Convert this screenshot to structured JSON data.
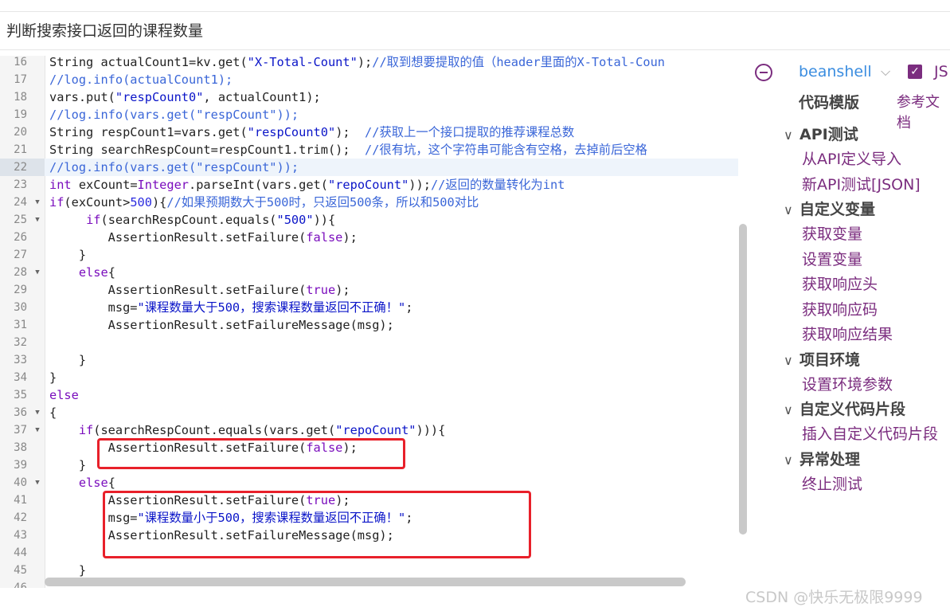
{
  "page_title": "判断搜索接口返回的课程数量",
  "code_lines": [
    {
      "n": "16",
      "fold": false,
      "active": false,
      "segs": [
        [
          "",
          "String actualCount1=kv.get("
        ],
        [
          "c-str",
          "\"X-Total-Count\""
        ],
        [
          "",
          ");"
        ],
        [
          "c-com",
          "//取到想要提取的值（header里面的X-Total-Coun"
        ]
      ]
    },
    {
      "n": "17",
      "fold": false,
      "active": false,
      "segs": [
        [
          "c-com",
          "//log.info(actualCount1);"
        ]
      ]
    },
    {
      "n": "18",
      "fold": false,
      "active": false,
      "segs": [
        [
          "",
          "vars.put("
        ],
        [
          "c-str",
          "\"respCount0\""
        ],
        [
          "",
          ", actualCount1);"
        ]
      ]
    },
    {
      "n": "19",
      "fold": false,
      "active": false,
      "segs": [
        [
          "c-com",
          "//log.info(vars.get(\"respCount\"));"
        ]
      ]
    },
    {
      "n": "20",
      "fold": false,
      "active": false,
      "segs": [
        [
          "",
          "String respCount1=vars.get("
        ],
        [
          "c-str",
          "\"respCount0\""
        ],
        [
          "",
          ");  "
        ],
        [
          "c-com",
          "//获取上一个接口提取的推荐课程总数"
        ]
      ]
    },
    {
      "n": "21",
      "fold": false,
      "active": false,
      "segs": [
        [
          "",
          "String searchRespCount=respCount1.trim();  "
        ],
        [
          "c-com",
          "//很有坑，这个字符串可能含有空格，去掉前后空格"
        ]
      ]
    },
    {
      "n": "22",
      "fold": false,
      "active": true,
      "segs": [
        [
          "c-com",
          "//log.info(vars.get(\"respCount\"));"
        ]
      ]
    },
    {
      "n": "23",
      "fold": false,
      "active": false,
      "segs": [
        [
          "c-kw",
          "int"
        ],
        [
          "",
          " exCount="
        ],
        [
          "c-kw",
          "Integer"
        ],
        [
          "",
          ".parseInt(vars.get("
        ],
        [
          "c-str",
          "\"repoCount\""
        ],
        [
          "",
          "));"
        ],
        [
          "c-com",
          "//返回的数量转化为int"
        ]
      ]
    },
    {
      "n": "24",
      "fold": true,
      "active": false,
      "segs": [
        [
          "c-kw",
          "if"
        ],
        [
          "",
          "(exCount>"
        ],
        [
          "c-num",
          "500"
        ],
        [
          "",
          "){"
        ],
        [
          "c-com",
          "//如果预期数大于500时，只返回500条，所以和500对比"
        ]
      ]
    },
    {
      "n": "25",
      "fold": true,
      "active": false,
      "segs": [
        [
          "",
          "     "
        ],
        [
          "c-kw",
          "if"
        ],
        [
          "",
          "(searchRespCount.equals("
        ],
        [
          "c-str",
          "\"500\""
        ],
        [
          "",
          "))"
        ],
        [
          "",
          "{"
        ]
      ]
    },
    {
      "n": "26",
      "fold": false,
      "active": false,
      "segs": [
        [
          "",
          "        AssertionResult.setFailure("
        ],
        [
          "c-kw",
          "false"
        ],
        [
          "",
          ");"
        ]
      ]
    },
    {
      "n": "27",
      "fold": false,
      "active": false,
      "segs": [
        [
          "",
          "    }"
        ]
      ]
    },
    {
      "n": "28",
      "fold": true,
      "active": false,
      "segs": [
        [
          "",
          "    "
        ],
        [
          "c-kw",
          "else"
        ],
        [
          "",
          "{"
        ]
      ]
    },
    {
      "n": "29",
      "fold": false,
      "active": false,
      "segs": [
        [
          "",
          "        AssertionResult.setFailure("
        ],
        [
          "c-kw",
          "true"
        ],
        [
          "",
          ");"
        ]
      ]
    },
    {
      "n": "30",
      "fold": false,
      "active": false,
      "segs": [
        [
          "",
          "        msg="
        ],
        [
          "c-str",
          "\"课程数量大于500，搜索课程数量返回不正确！\""
        ],
        [
          "",
          ";"
        ]
      ]
    },
    {
      "n": "31",
      "fold": false,
      "active": false,
      "segs": [
        [
          "",
          "        AssertionResult.setFailureMessage(msg);"
        ]
      ]
    },
    {
      "n": "32",
      "fold": false,
      "active": false,
      "segs": [
        [
          "",
          ""
        ]
      ]
    },
    {
      "n": "33",
      "fold": false,
      "active": false,
      "segs": [
        [
          "",
          "    }"
        ]
      ]
    },
    {
      "n": "34",
      "fold": false,
      "active": false,
      "segs": [
        [
          "",
          "}"
        ]
      ]
    },
    {
      "n": "35",
      "fold": false,
      "active": false,
      "segs": [
        [
          "c-kw",
          "else"
        ]
      ]
    },
    {
      "n": "36",
      "fold": true,
      "active": false,
      "segs": [
        [
          "",
          "{"
        ]
      ]
    },
    {
      "n": "37",
      "fold": true,
      "active": false,
      "segs": [
        [
          "",
          "    "
        ],
        [
          "c-kw",
          "if"
        ],
        [
          "",
          "(searchRespCount.equals(vars.get("
        ],
        [
          "c-str",
          "\"repoCount\""
        ],
        [
          "",
          ")))"
        ],
        [
          "",
          "{"
        ]
      ]
    },
    {
      "n": "38",
      "fold": false,
      "active": false,
      "segs": [
        [
          "",
          "        AssertionResult.setFailure("
        ],
        [
          "c-kw",
          "false"
        ],
        [
          "",
          ");"
        ]
      ]
    },
    {
      "n": "39",
      "fold": false,
      "active": false,
      "segs": [
        [
          "",
          "    }"
        ]
      ]
    },
    {
      "n": "40",
      "fold": true,
      "active": false,
      "segs": [
        [
          "",
          "    "
        ],
        [
          "c-kw",
          "else"
        ],
        [
          "",
          "{"
        ]
      ]
    },
    {
      "n": "41",
      "fold": false,
      "active": false,
      "segs": [
        [
          "",
          "        AssertionResult.setFailure("
        ],
        [
          "c-kw",
          "true"
        ],
        [
          "",
          ");"
        ]
      ]
    },
    {
      "n": "42",
      "fold": false,
      "active": false,
      "segs": [
        [
          "",
          "        msg="
        ],
        [
          "c-str",
          "\"课程数量小于500，搜索课程数量返回不正确！\""
        ],
        [
          "",
          ";"
        ]
      ]
    },
    {
      "n": "43",
      "fold": false,
      "active": false,
      "segs": [
        [
          "",
          "        AssertionResult.setFailureMessage(msg);"
        ]
      ]
    },
    {
      "n": "44",
      "fold": false,
      "active": false,
      "segs": [
        [
          "",
          ""
        ]
      ]
    },
    {
      "n": "45",
      "fold": false,
      "active": false,
      "segs": [
        [
          "",
          "    }"
        ]
      ]
    },
    {
      "n": "46",
      "fold": false,
      "active": false,
      "segs": [
        [
          "",
          ""
        ]
      ]
    }
  ],
  "sidebar": {
    "language": "beanshell",
    "js_label": "JS",
    "template_label": "代码模版",
    "ref_label": "参考文档",
    "groups": [
      {
        "label": "API测试",
        "items": [
          "从API定义导入",
          "新API测试[JSON]"
        ]
      },
      {
        "label": "自定义变量",
        "items": [
          "获取变量",
          "设置变量",
          "获取响应头",
          "获取响应码",
          "获取响应结果"
        ]
      },
      {
        "label": "项目环境",
        "items": [
          "设置环境参数"
        ]
      },
      {
        "label": "自定义代码片段",
        "items": [
          "插入自定义代码片段"
        ]
      },
      {
        "label": "异常处理",
        "items": [
          "终止测试"
        ]
      }
    ]
  },
  "watermark": "CSDN @快乐无极限9999",
  "highlight_color": "#e8202a"
}
